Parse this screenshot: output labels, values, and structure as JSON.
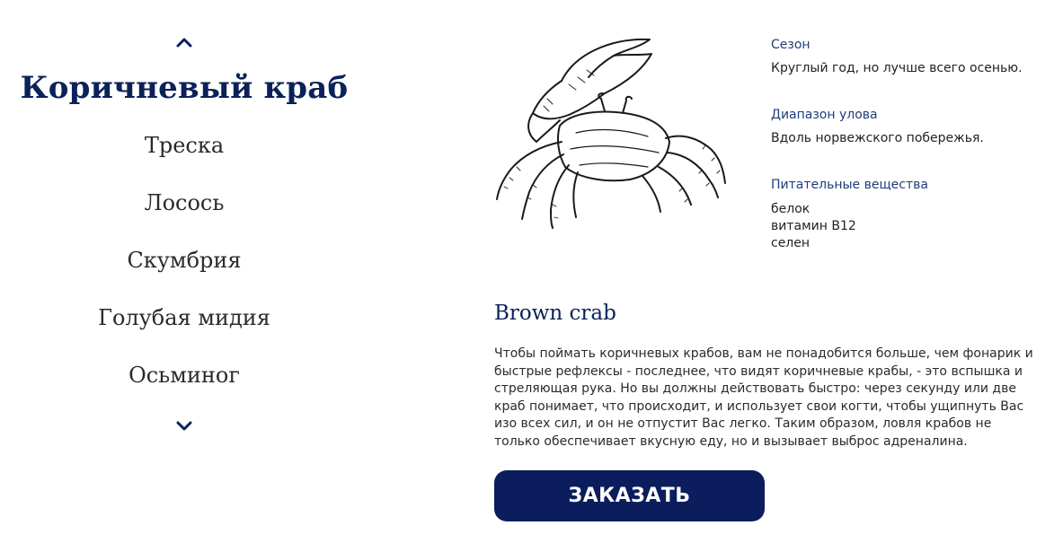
{
  "nav": {
    "up_icon": "chevron-up-icon",
    "down_icon": "chevron-down-icon",
    "active": "Коричневый краб",
    "items": [
      "Треска",
      "Лосось",
      "Скумбрия",
      "Голубая мидия",
      "Осьминог"
    ]
  },
  "crab_image": "crab-illustration",
  "info": {
    "season_label": "Сезон",
    "season_value": "Круглый год, но лучше всего осенью.",
    "range_label": "Диапазон улова",
    "range_value": "Вдоль норвежского побережья.",
    "nutrients_label": "Питательные вещества",
    "nutrients": [
      "белок",
      "витамин B12",
      "селен"
    ]
  },
  "product": {
    "title": "Brown crab",
    "description": "Чтобы поймать коричневых крабов, вам не понадобится больше, чем фонарик и быстрые рефлексы - последнее, что видят коричневые крабы, - это вспышка и стреляющая рука. Но вы должны действовать быстро: через секунду или две краб понимает, что происходит, и использует свои когти, чтобы ущипнуть Вас изо всех сил, и он не отпустит Вас легко. Таким образом, ловля крабов не только обеспечивает вкусную еду, но и вызывает выброс адреналина.",
    "order_label": "ЗАКАЗАТЬ"
  },
  "colors": {
    "navy": "#0b1d5c",
    "label_blue": "#1f3d7a"
  }
}
